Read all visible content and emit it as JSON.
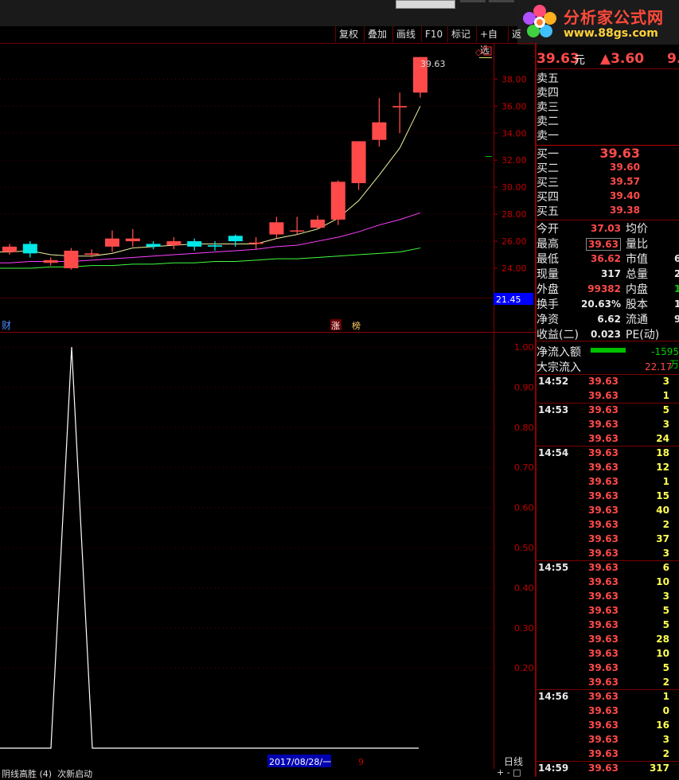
{
  "toolbar": {
    "buttons": [
      "复权",
      "叠加",
      "画线",
      "F10",
      "标记",
      "+自选",
      "返"
    ]
  },
  "logo": {
    "title": "分析家公式网",
    "url": "www.88gs.com"
  },
  "price_chart": {
    "last_price_label": "39.63",
    "y_ticks": [
      "38.00",
      "36.00",
      "34.00",
      "32.00",
      "30.00",
      "28.00",
      "26.00",
      "24.00"
    ],
    "level_box": "21.45",
    "flags": {
      "left": "财",
      "zhang": "涨",
      "bang": "榜"
    }
  },
  "indicator": {
    "y_ticks": [
      "1.00",
      "0.90",
      "0.80",
      "0.70",
      "0.60",
      "0.50",
      "0.40",
      "0.30",
      "0.20"
    ],
    "date_label": "2017/08/28/一",
    "date_suffix": "9",
    "period": "日线",
    "status_left": "阴线高胜 (4)  次新启动",
    "status_right": "+ - □"
  },
  "quote": {
    "price": "39.63",
    "unit": "元",
    "change": "▲3.60",
    "change_pct": "9.",
    "sell": [
      {
        "label": "卖五",
        "price": "",
        "vol": ""
      },
      {
        "label": "卖四",
        "price": "",
        "vol": ""
      },
      {
        "label": "卖三",
        "price": "",
        "vol": ""
      },
      {
        "label": "卖二",
        "price": "",
        "vol": ""
      },
      {
        "label": "卖一",
        "price": "",
        "vol": ""
      }
    ],
    "buy": [
      {
        "label": "买一",
        "price": "39.63"
      },
      {
        "label": "买二",
        "price": "39.60"
      },
      {
        "label": "买三",
        "price": "39.57"
      },
      {
        "label": "买四",
        "price": "39.40"
      },
      {
        "label": "买五",
        "price": "39.38"
      }
    ],
    "stats": [
      {
        "l1": "今开",
        "v1": "37.03",
        "l2": "均价",
        "v2": ""
      },
      {
        "l1": "最高",
        "v1": "39.63",
        "l2": "量比",
        "v2": ""
      },
      {
        "l1": "最低",
        "v1": "36.62",
        "l2": "市值",
        "v2": "6"
      },
      {
        "l1": "现量",
        "v1": "317",
        "l2": "总量",
        "v2": "20"
      },
      {
        "l1": "外盘",
        "v1": "99382",
        "l2": "内盘",
        "v2": "1"
      },
      {
        "l1": "换手",
        "v1": "20.63%",
        "l2": "股本",
        "v2": "1"
      },
      {
        "l1": "净资",
        "v1": "6.62",
        "l2": "流通",
        "v2": "9"
      },
      {
        "l1": "收益(二)",
        "v1": "0.023",
        "l2": "PE(动)",
        "v2": ""
      }
    ],
    "flow": [
      {
        "label": "净流入额",
        "value": "-1595万"
      },
      {
        "label": "大宗流入",
        "value": "22.17"
      }
    ],
    "ticks": [
      {
        "time": "14:52",
        "price": "39.63",
        "vol": "3"
      },
      {
        "time": "",
        "price": "39.63",
        "vol": "1"
      },
      {
        "time": "14:53",
        "price": "39.63",
        "vol": "5"
      },
      {
        "time": "",
        "price": "39.63",
        "vol": "3"
      },
      {
        "time": "",
        "price": "39.63",
        "vol": "24"
      },
      {
        "time": "14:54",
        "price": "39.63",
        "vol": "18"
      },
      {
        "time": "",
        "price": "39.63",
        "vol": "12"
      },
      {
        "time": "",
        "price": "39.63",
        "vol": "1"
      },
      {
        "time": "",
        "price": "39.63",
        "vol": "15"
      },
      {
        "time": "",
        "price": "39.63",
        "vol": "40"
      },
      {
        "time": "",
        "price": "39.63",
        "vol": "2"
      },
      {
        "time": "",
        "price": "39.63",
        "vol": "37"
      },
      {
        "time": "",
        "price": "39.63",
        "vol": "3"
      },
      {
        "time": "14:55",
        "price": "39.63",
        "vol": "6"
      },
      {
        "time": "",
        "price": "39.63",
        "vol": "10"
      },
      {
        "time": "",
        "price": "39.63",
        "vol": "3"
      },
      {
        "time": "",
        "price": "39.63",
        "vol": "5"
      },
      {
        "time": "",
        "price": "39.63",
        "vol": "5"
      },
      {
        "time": "",
        "price": "39.63",
        "vol": "28"
      },
      {
        "time": "",
        "price": "39.63",
        "vol": "10"
      },
      {
        "time": "",
        "price": "39.63",
        "vol": "5"
      },
      {
        "time": "",
        "price": "39.63",
        "vol": "2"
      },
      {
        "time": "14:56",
        "price": "39.63",
        "vol": "1"
      },
      {
        "time": "",
        "price": "39.63",
        "vol": "0"
      },
      {
        "time": "",
        "price": "39.63",
        "vol": "16"
      },
      {
        "time": "",
        "price": "39.63",
        "vol": "3"
      },
      {
        "time": "",
        "price": "39.63",
        "vol": "2"
      },
      {
        "time": "14:59",
        "price": "39.63",
        "vol": "317"
      }
    ]
  },
  "colors": {
    "up": "#ff4a4a",
    "down": "#00e8e8",
    "grid": "#6b0000",
    "ma5": "#f0f0a0",
    "ma10": "#ff40ff",
    "ma20": "#40ff40"
  },
  "chart_data": {
    "type": "candlestick",
    "ylim": [
      23,
      39.63
    ],
    "candles": [
      {
        "o": 25.2,
        "c": 25.6,
        "h": 25.8,
        "l": 25.0
      },
      {
        "o": 25.8,
        "c": 25.1,
        "h": 26.0,
        "l": 24.8
      },
      {
        "o": 24.4,
        "c": 24.6,
        "h": 24.8,
        "l": 24.2
      },
      {
        "o": 24.0,
        "c": 25.3,
        "h": 25.5,
        "l": 23.9
      },
      {
        "o": 25.0,
        "c": 25.1,
        "h": 25.4,
        "l": 24.8
      },
      {
        "o": 25.6,
        "c": 26.2,
        "h": 26.8,
        "l": 25.2
      },
      {
        "o": 26.0,
        "c": 26.2,
        "h": 26.9,
        "l": 25.6
      },
      {
        "o": 25.8,
        "c": 25.6,
        "h": 26.0,
        "l": 25.4
      },
      {
        "o": 25.7,
        "c": 26.0,
        "h": 26.3,
        "l": 25.4
      },
      {
        "o": 26.0,
        "c": 25.6,
        "h": 26.2,
        "l": 25.3
      },
      {
        "o": 25.7,
        "c": 25.6,
        "h": 26.0,
        "l": 25.3
      },
      {
        "o": 26.4,
        "c": 26.0,
        "h": 26.5,
        "l": 25.6
      },
      {
        "o": 25.8,
        "c": 25.9,
        "h": 26.3,
        "l": 25.4
      },
      {
        "o": 26.5,
        "c": 27.4,
        "h": 27.8,
        "l": 26.2
      },
      {
        "o": 26.8,
        "c": 26.8,
        "h": 27.8,
        "l": 26.5
      },
      {
        "o": 27.0,
        "c": 27.6,
        "h": 27.9,
        "l": 26.9
      },
      {
        "o": 27.6,
        "c": 30.4,
        "h": 30.5,
        "l": 27.2
      },
      {
        "o": 30.3,
        "c": 33.4,
        "h": 33.4,
        "l": 29.8
      },
      {
        "o": 33.5,
        "c": 34.8,
        "h": 36.6,
        "l": 33.0
      },
      {
        "o": 35.9,
        "c": 36.0,
        "h": 37.0,
        "l": 34.0
      },
      {
        "o": 37.0,
        "c": 39.63,
        "h": 39.63,
        "l": 36.62
      }
    ],
    "ma5": [
      25.2,
      25.3,
      25.0,
      24.9,
      24.9,
      25.1,
      25.5,
      25.6,
      25.7,
      25.8,
      25.8,
      25.8,
      25.8,
      26.2,
      26.5,
      26.9,
      27.7,
      29.0,
      30.9,
      32.9,
      36.0
    ],
    "ma10": [
      24.4,
      24.5,
      24.5,
      24.5,
      24.6,
      24.7,
      24.8,
      24.9,
      25.0,
      25.1,
      25.2,
      25.3,
      25.4,
      25.6,
      25.7,
      26.0,
      26.3,
      26.7,
      27.2,
      27.6,
      28.1
    ],
    "ma20": [
      24.0,
      24.0,
      24.1,
      24.1,
      24.2,
      24.2,
      24.3,
      24.3,
      24.4,
      24.4,
      24.5,
      24.5,
      24.6,
      24.7,
      24.7,
      24.8,
      24.9,
      25.0,
      25.1,
      25.2,
      25.5
    ],
    "indicator_series": [
      0,
      0,
      0,
      0,
      0,
      0,
      0,
      0,
      0,
      0,
      0,
      0,
      0,
      0,
      0,
      0,
      0,
      0,
      0,
      0,
      0
    ],
    "indicator_peak": {
      "index": 1,
      "value": 1.0
    }
  }
}
